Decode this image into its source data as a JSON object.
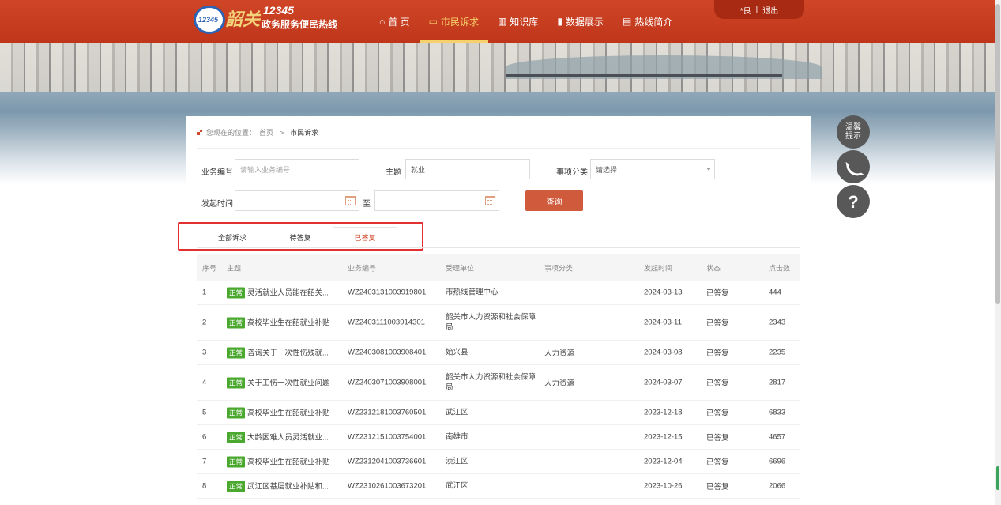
{
  "logo": {
    "number": "12345",
    "script": "韶关",
    "name": "政务服务便民热线",
    "badge": "12345"
  },
  "nav": [
    {
      "label": "首 页",
      "icon": "home-icon",
      "glyph": "⌂"
    },
    {
      "label": "市民诉求",
      "icon": "chat-icon",
      "glyph": "▭"
    },
    {
      "label": "知识库",
      "icon": "book-icon",
      "glyph": "▥"
    },
    {
      "label": "数据展示",
      "icon": "bar-chart-icon",
      "glyph": "▮"
    },
    {
      "label": "热线简介",
      "icon": "document-icon",
      "glyph": "▤"
    }
  ],
  "active_nav": "市民诉求",
  "user": {
    "name": "*良",
    "separator": "|",
    "logout": "退出"
  },
  "breadcrumb": {
    "prefix": "您现在的位置：",
    "home": "首页",
    "sep": ">",
    "current": "市民诉求"
  },
  "form": {
    "code_label": "业务编号",
    "code_placeholder": "请输入业务编号",
    "subject_label": "主题",
    "subject_value": "就业",
    "category_label": "事项分类",
    "category_value": "请选择",
    "time_label": "发起时间",
    "time_to": "至",
    "query_button": "查询"
  },
  "tabs": [
    "全部诉求",
    "待答复",
    "已答复"
  ],
  "active_tab": "已答复",
  "table": {
    "headers": [
      "序号",
      "主题",
      "业务编号",
      "受理单位",
      "事项分类",
      "发起时间",
      "状态",
      "点击数"
    ],
    "rows": [
      {
        "no": "1",
        "tag": "正常",
        "subject": "灵活就业人员能在韶关...",
        "code": "WZ2403131003919801",
        "unit": "市热线管理中心",
        "category": "",
        "date": "2024-03-13",
        "status": "已答复",
        "clicks": "444"
      },
      {
        "no": "2",
        "tag": "正常",
        "subject": "高校毕业生在韶就业补贴",
        "code": "WZ2403111003914301",
        "unit": "韶关市人力资源和社会保障局",
        "category": "",
        "date": "2024-03-11",
        "status": "已答复",
        "clicks": "2343"
      },
      {
        "no": "3",
        "tag": "正常",
        "subject": "咨询关于一次性伤残就...",
        "code": "WZ2403081003908401",
        "unit": "始兴县",
        "category": "人力资源",
        "date": "2024-03-08",
        "status": "已答复",
        "clicks": "2235"
      },
      {
        "no": "4",
        "tag": "正常",
        "subject": "关于工伤一次性就业问题",
        "code": "WZ2403071003908001",
        "unit": "韶关市人力资源和社会保障局",
        "category": "人力资源",
        "date": "2024-03-07",
        "status": "已答复",
        "clicks": "2817"
      },
      {
        "no": "5",
        "tag": "正常",
        "subject": "高校毕业生在韶就业补贴",
        "code": "WZ2312181003760501",
        "unit": "武江区",
        "category": "",
        "date": "2023-12-18",
        "status": "已答复",
        "clicks": "6833"
      },
      {
        "no": "6",
        "tag": "正常",
        "subject": "大龄困难人员灵活就业...",
        "code": "WZ2312151003754001",
        "unit": "南雄市",
        "category": "",
        "date": "2023-12-15",
        "status": "已答复",
        "clicks": "4657"
      },
      {
        "no": "7",
        "tag": "正常",
        "subject": "高校毕业生在韶就业补贴",
        "code": "WZ2312041003736601",
        "unit": "浈江区",
        "category": "",
        "date": "2023-12-04",
        "status": "已答复",
        "clicks": "6696"
      },
      {
        "no": "8",
        "tag": "正常",
        "subject": "武江区基层就业补贴和...",
        "code": "WZ2310261003673201",
        "unit": "武江区",
        "category": "",
        "date": "2023-10-26",
        "status": "已答复",
        "clicks": "2066"
      }
    ]
  },
  "side": {
    "tip": "温馨\n提示",
    "phone_icon": "phone-icon",
    "help_icon": "question-icon",
    "help_glyph": "?"
  },
  "colors": {
    "header": "#c9401f",
    "accent": "#d0482a",
    "tag": "#4aa82f",
    "nav_active": "#f6d06a",
    "highlight_box": "#e23030"
  }
}
